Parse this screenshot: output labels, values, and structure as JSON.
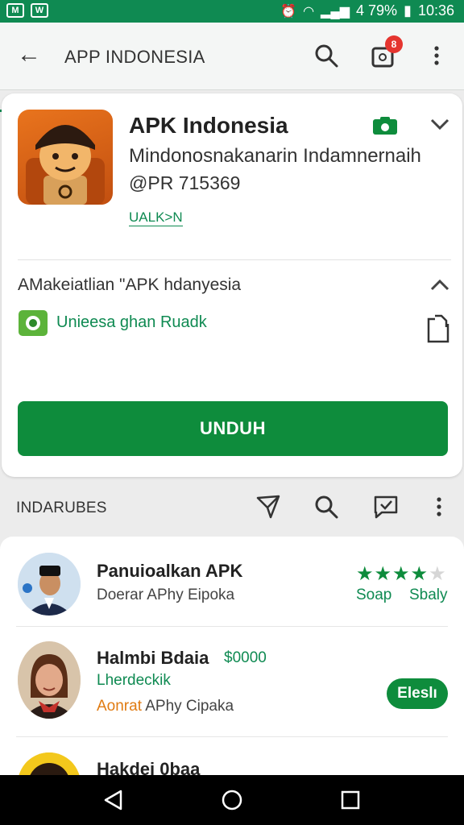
{
  "status_bar": {
    "left_icons": [
      "M",
      "W"
    ],
    "battery": "4 79%",
    "time": "10:36",
    "badge_color": "#0f8a52"
  },
  "app_bar": {
    "title": "APP INDONESIA",
    "notification_count": "8"
  },
  "app": {
    "name": "APK Indonesia",
    "subtitle": "Mindonosnakanarin Indamnernaih",
    "id": "@PR 715369",
    "tag": "UALK>N",
    "section_title": "AMakeiatlian \"APK hdanyesia",
    "developer": "Unieesa ghan Ruadk",
    "download_label": "UNDUH",
    "accent_color": "#0e8c3c"
  },
  "list": {
    "header": "INDARUBES",
    "items": [
      {
        "title": "Panuioalkan APK",
        "subtitle": "Doerar APhy Eipoka",
        "rating": 4,
        "tag_left": "Soap",
        "tag_right": "Sbaly"
      },
      {
        "title": "Halmbi Bdaia",
        "price": "$0000",
        "green_sub": "Lherdeckik",
        "sub_orange": "Aonrat",
        "sub_rest": "APhy Cipaka",
        "pill": "Eleslı"
      },
      {
        "title": "Hakdei 0baa"
      }
    ]
  }
}
